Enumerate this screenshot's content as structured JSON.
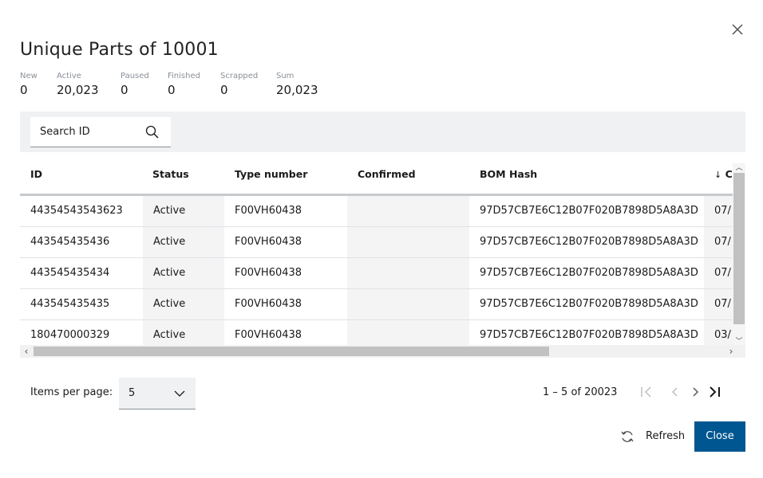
{
  "dialog": {
    "title": "Unique Parts of 10001",
    "close_icon": "close-icon"
  },
  "stats": [
    {
      "label": "New",
      "value": "0"
    },
    {
      "label": "Active",
      "value": "20,023"
    },
    {
      "label": "Paused",
      "value": "0"
    },
    {
      "label": "Finished",
      "value": "0"
    },
    {
      "label": "Scrapped",
      "value": "0"
    },
    {
      "label": "Sum",
      "value": "20,023"
    }
  ],
  "search": {
    "placeholder": "Search ID",
    "icon": "search-icon"
  },
  "table": {
    "columns": [
      "ID",
      "Status",
      "Type number",
      "Confirmed",
      "BOM Hash",
      "C"
    ],
    "sort_column": "C",
    "sort_direction": "descending",
    "rows": [
      {
        "id": "44354543543623",
        "status": "Active",
        "type_number": "F00VH60438",
        "confirmed": "",
        "bom_hash": "97D57CB7E6C12B07F020B7898D5A8A3D",
        "c": "07/"
      },
      {
        "id": "443545435436",
        "status": "Active",
        "type_number": "F00VH60438",
        "confirmed": "",
        "bom_hash": "97D57CB7E6C12B07F020B7898D5A8A3D",
        "c": "07/"
      },
      {
        "id": "443545435434",
        "status": "Active",
        "type_number": "F00VH60438",
        "confirmed": "",
        "bom_hash": "97D57CB7E6C12B07F020B7898D5A8A3D",
        "c": "07/"
      },
      {
        "id": "443545435435",
        "status": "Active",
        "type_number": "F00VH60438",
        "confirmed": "",
        "bom_hash": "97D57CB7E6C12B07F020B7898D5A8A3D",
        "c": "07/"
      },
      {
        "id": "180470000329",
        "status": "Active",
        "type_number": "F00VH60438",
        "confirmed": "",
        "bom_hash": "97D57CB7E6C12B07F020B7898D5A8A3D",
        "c": "03/"
      }
    ]
  },
  "pagination": {
    "items_per_page_label": "Items per page:",
    "items_per_page_value": "5",
    "range_label": "1 – 5 of 20023"
  },
  "actions": {
    "refresh_label": "Refresh",
    "close_label": "Close"
  },
  "colors": {
    "primary": "#005691",
    "toolbar_bg": "#eff1f2",
    "shaded_column": "#f4f4f5"
  }
}
